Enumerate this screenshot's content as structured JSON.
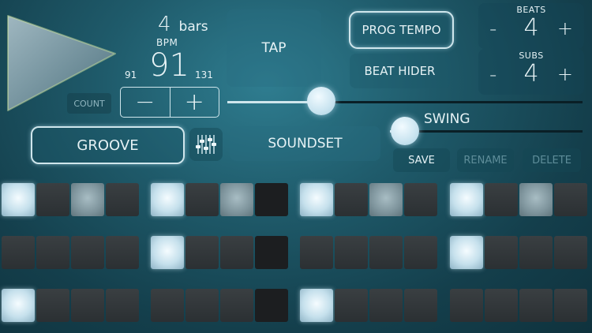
{
  "transport": {
    "play_icon": "play-icon",
    "bars_value": "4",
    "bars_label": "bars",
    "bpm_label": "BPM",
    "bpm_value": "91",
    "bpm_min": "91",
    "bpm_max": "131",
    "count_label": "COUNT",
    "minus_label": "−",
    "plus_label": "+",
    "tap_label": "TAP",
    "prog_tempo_label": "PROG TEMPO",
    "beat_hider_label": "BEAT HIDER"
  },
  "beats": {
    "title": "BEATS",
    "value": "4",
    "minus": "-",
    "plus": "+"
  },
  "subs": {
    "title": "SUBS",
    "value": "4",
    "minus": "-",
    "plus": "+"
  },
  "tempo_slider": {
    "position": 0.27
  },
  "swing": {
    "label": "SWING",
    "position": 0.0
  },
  "groove_label": "GROOVE",
  "mixer_icon": "mixer-sliders-icon",
  "soundset_label": "SOUNDSET",
  "actions": {
    "save": "SAVE",
    "rename": "RENAME",
    "delete": "DELETE"
  },
  "colors": {
    "accent": "#cfe6ec",
    "background": "#1f5b6b",
    "pad_off": "#33393c"
  },
  "pattern": [
    [
      "bright",
      "off",
      "medium",
      "off",
      "bright",
      "off",
      "medium",
      "dim",
      "bright",
      "off",
      "medium",
      "off",
      "bright",
      "off",
      "medium",
      "off"
    ],
    [
      "off",
      "off",
      "off",
      "off",
      "bright",
      "off",
      "off",
      "dim",
      "off",
      "off",
      "off",
      "off",
      "bright",
      "off",
      "off",
      "off"
    ],
    [
      "bright",
      "off",
      "off",
      "off",
      "off",
      "off",
      "off",
      "dim",
      "bright",
      "off",
      "off",
      "off",
      "off",
      "off",
      "off",
      "off"
    ]
  ]
}
